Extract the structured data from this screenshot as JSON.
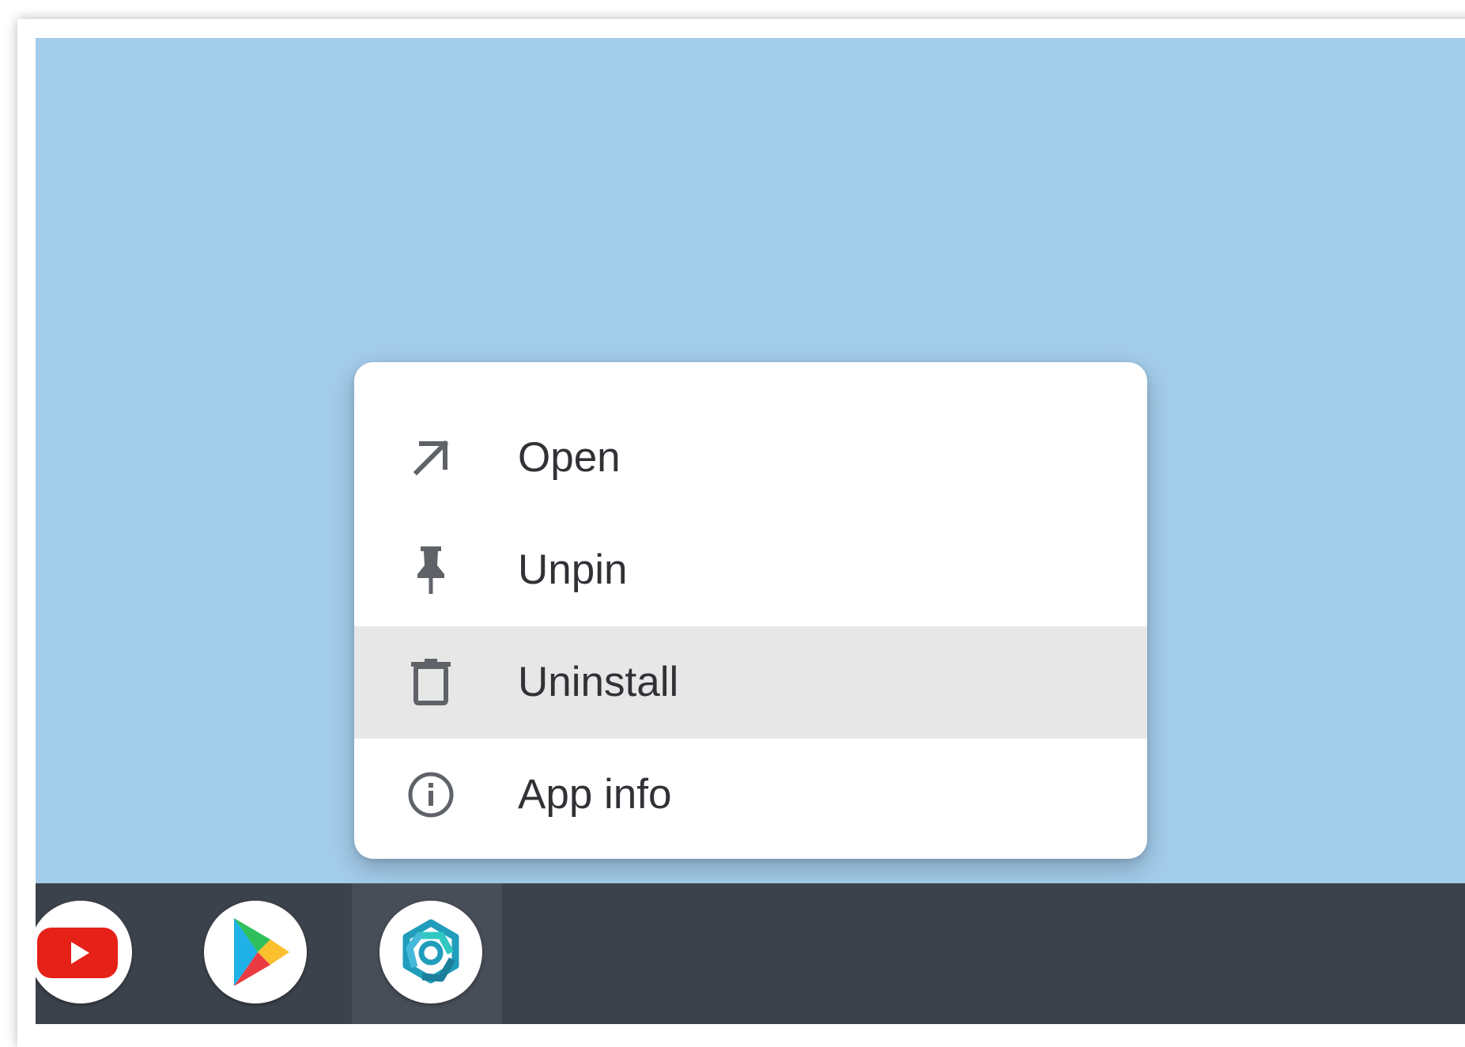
{
  "desktop": {
    "wallpaper_color": "#a3cbea"
  },
  "context_menu": {
    "items": [
      {
        "label": "Open",
        "icon": "arrow-up-right-icon",
        "highlighted": false
      },
      {
        "label": "Unpin",
        "icon": "pin-icon",
        "highlighted": false
      },
      {
        "label": "Uninstall",
        "icon": "trash-icon",
        "highlighted": true
      },
      {
        "label": "App info",
        "icon": "info-icon",
        "highlighted": false
      }
    ]
  },
  "shelf": {
    "background_color": "#3c424b",
    "apps": [
      {
        "name": "youtube-app",
        "icon": "youtube-icon",
        "active": false
      },
      {
        "name": "play-store-app",
        "icon": "play-store-icon",
        "active": false
      },
      {
        "name": "teal-app",
        "icon": "teal-app-icon",
        "active": true
      }
    ]
  },
  "colors": {
    "highlight": "#e7e7e8",
    "menu_text": "#303236",
    "icon": "#5f6368"
  }
}
